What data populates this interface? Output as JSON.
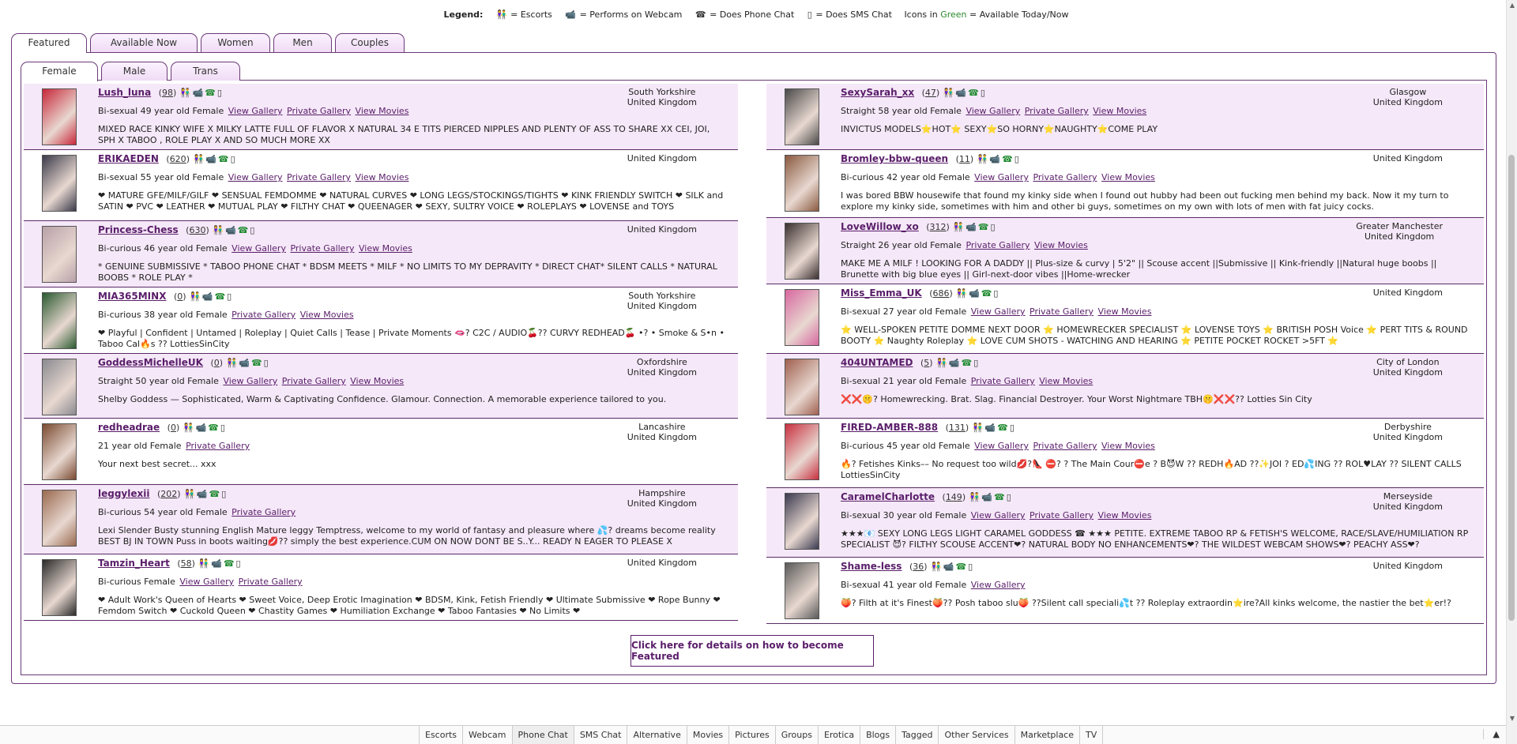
{
  "legend": {
    "title": "Legend:",
    "escorts": "= Escorts",
    "webcam": "= Performs on Webcam",
    "phone": "= Does Phone Chat",
    "sms": "= Does SMS Chat",
    "icons_in": "Icons in",
    "green": "Green",
    "available": "= Available Today/Now"
  },
  "tabs_primary": [
    "Featured",
    "Available Now",
    "Women",
    "Men",
    "Couples"
  ],
  "tabs_secondary": [
    "Female",
    "Male",
    "Trans"
  ],
  "icons": {
    "escort": "escort-icon",
    "webcam": "webcam-icon",
    "phone": "phone-icon",
    "sms": "sms-icon"
  },
  "left": [
    {
      "name": "Lush_luna",
      "count": "98",
      "orient": "Bi-sexual 49 year old Female",
      "links": [
        "View Gallery",
        "Private Gallery",
        "View Movies"
      ],
      "loc1": "South Yorkshire",
      "loc2": "United Kingdom",
      "desc": "MIXED RACE KINKY WIFE X MILKY LATTE FULL OF FLAVOR X NATURAL 34 E TITS PIERCED NIPPLES AND PLENTY OF ASS TO SHARE XX CEI, JOI, SPH X TABOO , ROLE PLAY X AND SO MUCH MORE XX",
      "color": "#c8283a"
    },
    {
      "name": "ERIKAEDEN",
      "count": "620",
      "orient": "Bi-sexual 55 year old Female",
      "links": [
        "View Gallery",
        "Private Gallery",
        "View Movies"
      ],
      "loc1": "United Kingdom",
      "loc2": "",
      "desc": "❤ MATURE GFE/MILF/GILF ❤ SENSUAL FEMDOMME ❤ NATURAL CURVES ❤ LONG LEGS/STOCKINGS/TIGHTS ❤ KINK FRIENDLY SWITCH ❤ SILK and SATIN ❤ PVC ❤ LEATHER ❤ MUTUAL PLAY ❤ FILTHY CHAT ❤ QUEENAGER ❤ SEXY, SULTRY VOICE ❤ ROLEPLAYS ❤ LOVENSE and TOYS",
      "color": "#3a3a4a"
    },
    {
      "name": "Princess-Chess",
      "count": "630",
      "orient": "Bi-curious 46 year old Female",
      "links": [
        "View Gallery",
        "Private Gallery",
        "View Movies"
      ],
      "loc1": "United Kingdom",
      "loc2": "",
      "desc": "* GENUINE SUBMISSIVE * TABOO PHONE CHAT * BDSM MEETS * MILF * NO LIMITS TO MY DEPRAVITY * DIRECT CHAT* SILENT CALLS * NATURAL BOOBS * ROLE PLAY *",
      "color": "#b8a0a8"
    },
    {
      "name": "MIA365MINX",
      "count": "0",
      "orient": "Bi-curious 38 year old Female",
      "links": [
        "Private Gallery",
        "View Movies"
      ],
      "loc1": "South Yorkshire",
      "loc2": "United Kingdom",
      "desc": "❤ Playful | Confident | Untamed | Roleplay | Quiet Calls | Tease | Private Moments 🫦? C2C / AUDIO🍒?? CURVY REDHEAD🍒 •? • Smoke & S•n • Taboo Cal🔥s ?? LottiesSinCity",
      "color": "#2a5a30"
    },
    {
      "name": "GoddessMichelleUK",
      "count": "0",
      "orient": "Straight 50 year old Female",
      "links": [
        "View Gallery",
        "Private Gallery",
        "View Movies"
      ],
      "loc1": "Oxfordshire",
      "loc2": "United Kingdom",
      "desc": "Shelby Goddess — Sophisticated, Warm & Captivating Confidence. Glamour. Connection. A memorable experience tailored to you.",
      "color": "#8a8a90"
    },
    {
      "name": "redheadrae",
      "count": "0",
      "orient": "21 year old Female",
      "links": [
        "Private Gallery"
      ],
      "loc1": "Lancashire",
      "loc2": "United Kingdom",
      "desc": "Your next best secret... xxx",
      "color": "#7a4a30"
    },
    {
      "name": "leggylexii",
      "count": "202",
      "orient": "Bi-curious 54 year old Female",
      "links": [
        "Private Gallery"
      ],
      "loc1": "Hampshire",
      "loc2": "United Kingdom",
      "desc": "Lexi Slender Busty stunning English Mature leggy Temptress, welcome to my world of fantasy and pleasure where 💦? dreams become reality BEST BJ IN TOWN Puss in boots waiting💋?? simply the best experience.CUM ON NOW DONT BE S..Y... READY N EAGER TO PLEASE X",
      "color": "#9a6a50"
    },
    {
      "name": "Tamzin_Heart",
      "count": "58",
      "orient": "Bi-curious Female",
      "links": [
        "View Gallery",
        "Private Gallery"
      ],
      "loc1": "United Kingdom",
      "loc2": "",
      "desc": "❤ Adult Work's Queen of Hearts ❤ Sweet Voice, Deep Erotic Imagination ❤ BDSM, Kink, Fetish Friendly ❤ Ultimate Submissive ❤ Rope Bunny ❤ Femdom Switch ❤ Cuckold Queen ❤ Chastity Games ❤ Humiliation Exchange ❤ Taboo Fantasies ❤ No Limits ❤",
      "color": "#2a2a2a"
    }
  ],
  "right": [
    {
      "name": "SexySarah_xx",
      "count": "47",
      "orient": "Straight 58 year old Female",
      "links": [
        "View Gallery",
        "Private Gallery",
        "View Movies"
      ],
      "loc1": "Glasgow",
      "loc2": "United Kingdom",
      "desc": "INVICTUS MODELS⭐HOT⭐ SEXY⭐SO HORNY⭐NAUGHTY⭐COME PLAY",
      "color": "#4a4a4a"
    },
    {
      "name": "Bromley-bbw-queen",
      "count": "11",
      "orient": "Bi-curious 42 year old Female",
      "links": [
        "View Gallery",
        "Private Gallery",
        "View Movies"
      ],
      "loc1": "United Kingdom",
      "loc2": "",
      "desc": "I was bored BBW housewife that found my kinky side when I found out hubby had been out fucking men behind my back. Now it my turn to explore my kinky side, sometimes with him and other bi guys, sometimes on my own with lots of men with fat juicy cocks.",
      "color": "#8a5a40"
    },
    {
      "name": "LoveWillow_xo",
      "count": "312",
      "orient": "Straight 26 year old Female",
      "links": [
        "Private Gallery",
        "View Movies"
      ],
      "loc1": "Greater Manchester",
      "loc2": "United Kingdom",
      "desc": "MAKE ME A MILF ! LOOKING FOR A DADDY || Plus-size & curvy | 5'2\" || Scouse accent ||Submissive || Kink-friendly ||Natural huge boobs || Brunette with big blue eyes || Girl-next-door vibes ||Home-wrecker",
      "color": "#3a3030"
    },
    {
      "name": "Miss_Emma_UK",
      "count": "686",
      "orient": "Bi-sexual 27 year old Female",
      "links": [
        "View Gallery",
        "Private Gallery",
        "View Movies"
      ],
      "loc1": "United Kingdom",
      "loc2": "",
      "desc": "⭐ WELL-SPOKEN PETITE DOMME NEXT DOOR ⭐ HOMEWRECKER SPECIALIST ⭐ LOVENSE TOYS ⭐ BRITISH POSH Voice ⭐ PERT TITS & ROUND BOOTY ⭐ Naughty Roleplay ⭐ LOVE CUM SHOTS - WATCHING AND HEARING ⭐ PETITE POCKET ROCKET >5FT ⭐",
      "color": "#d868a0"
    },
    {
      "name": "404UNTAMED",
      "count": "5",
      "orient": "Bi-sexual 21 year old Female",
      "links": [
        "Private Gallery",
        "View Movies"
      ],
      "loc1": "City of London",
      "loc2": "United Kingdom",
      "desc": "❌❌🤫? Homewrecking. Brat. Slag. Financial Destroyer. Your Worst Nightmare TBH🤫❌❌?? Lotties Sin City",
      "color": "#a06050"
    },
    {
      "name": "FIRED-AMBER-888",
      "count": "131",
      "orient": "Bi-curious 45 year old Female",
      "links": [
        "View Gallery",
        "Private Gallery",
        "View Movies"
      ],
      "loc1": "Derbyshire",
      "loc2": "United Kingdom",
      "desc": "🔥? Fetishes Kinks–– No request too wild💋?👠 ⛔? ? The Main Cour⛔e ? B😈W ?? REDH🔥AD ??✨JOI ? ED💦ING ?? ROL♥LAY ?? SILENT CALLS LottiesSinCity",
      "color": "#c83040"
    },
    {
      "name": "CaramelCharlotte",
      "count": "149",
      "orient": "Bi-sexual 30 year old Female",
      "links": [
        "View Gallery",
        "Private Gallery",
        "View Movies"
      ],
      "loc1": "Merseyside",
      "loc2": "United Kingdom",
      "desc": "★★★📧 SEXY LONG LEGS LIGHT CARAMEL GODDESS ☎ ★★★ PETITE. EXTREME TABOO RP & FETISH'S WELCOME, RACE/SLAVE/HUMILIATION RP SPECIALIST 😈? FILTHY SCOUSE ACCENT❤? NATURAL BODY NO ENHANCEMENTS❤? THE WILDEST WEBCAM SHOWS❤? PEACHY ASS❤?",
      "color": "#3a3a50"
    },
    {
      "name": "Shame-less",
      "count": "36",
      "orient": "Bi-sexual 41 year old Female",
      "links": [
        "View Gallery"
      ],
      "loc1": "United Kingdom",
      "loc2": "",
      "desc": "🍑? Filth at it's Finest🍑?? Posh taboo slu🍑 ??Silent call speciali💦t ?? Roleplay extraordin⭐ire?All kinks welcome, the nastier the bet⭐er!?",
      "color": "#5a5a5a"
    }
  ],
  "featured_button": "Click here for details on how to become Featured",
  "footer_nav": [
    "Escorts",
    "Webcam",
    "Phone Chat",
    "SMS Chat",
    "Alternative",
    "Movies",
    "Pictures",
    "Groups",
    "Erotica",
    "Blogs",
    "Tagged",
    "Other Services",
    "Marketplace",
    "TV"
  ]
}
